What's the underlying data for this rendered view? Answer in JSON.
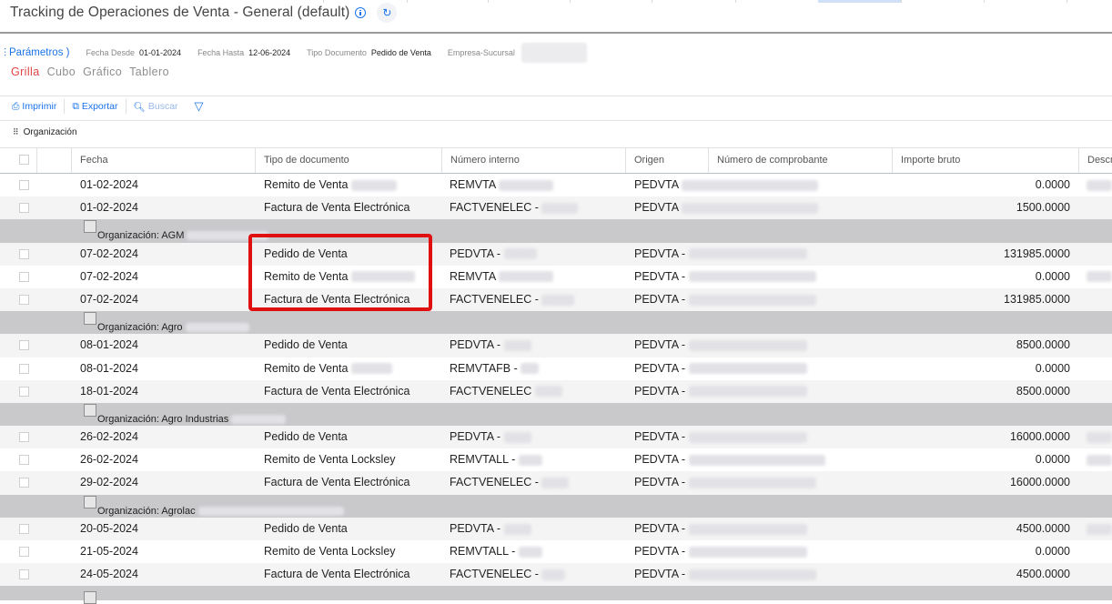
{
  "page": {
    "title": "Tracking de Operaciones de Venta - General (default)"
  },
  "params": {
    "link_label": "Parámetros )",
    "fecha_desde_label": "Fecha Desde",
    "fecha_desde_value": "01-01-2024",
    "fecha_hasta_label": "Fecha Hasta",
    "fecha_hasta_value": "12-06-2024",
    "tipo_doc_label": "Tipo Documento",
    "tipo_doc_value": "Pedido de Venta",
    "empresa_label": "Empresa-Sucursal"
  },
  "views": [
    "Grilla",
    "Cubo",
    "Gráfico",
    "Tablero"
  ],
  "toolbar": {
    "imprimir": "Imprimir",
    "exportar": "Exportar",
    "buscar": "Buscar"
  },
  "grouping_label": "Organización",
  "columns": [
    "Fecha",
    "Tipo de documento",
    "Número interno",
    "Origen",
    "Número de comprobante",
    "Importe bruto",
    "Descr"
  ],
  "rows_a": [
    {
      "fecha": "01-02-2024",
      "tipo": "Remito de Venta",
      "interno": "REMVTA",
      "origen": "PEDVTA",
      "importe": "0.0000"
    },
    {
      "fecha": "01-02-2024",
      "tipo": "Factura de Venta Electrónica",
      "interno": "FACTVENELEC -",
      "origen": "PEDVTA",
      "importe": "1500.0000"
    }
  ],
  "group_1": "Organización: AGM",
  "rows_b": [
    {
      "fecha": "07-02-2024",
      "tipo": "Pedido de Venta",
      "interno": "PEDVTA -",
      "origen": "PEDVTA -",
      "importe": "131985.0000"
    },
    {
      "fecha": "07-02-2024",
      "tipo": "Remito de Venta",
      "interno": "REMVTA",
      "origen": "PEDVTA -",
      "importe": "0.0000"
    },
    {
      "fecha": "07-02-2024",
      "tipo": "Factura de Venta Electrónica",
      "interno": "FACTVENELEC -",
      "origen": "PEDVTA -",
      "importe": "131985.0000"
    }
  ],
  "group_2": "Organización: Agro",
  "rows_c": [
    {
      "fecha": "08-01-2024",
      "tipo": "Pedido de Venta",
      "interno": "PEDVTA -",
      "origen": "PEDVTA -",
      "importe": "8500.0000"
    },
    {
      "fecha": "08-01-2024",
      "tipo": "Remito de Venta",
      "interno": "REMVTAFB -",
      "origen": "PEDVTA -",
      "importe": "0.0000"
    },
    {
      "fecha": "18-01-2024",
      "tipo": "Factura de Venta Electrónica",
      "interno": "FACTVENELEC",
      "origen": "PEDVTA -",
      "importe": "8500.0000"
    }
  ],
  "group_3": "Organización: Agro Industrias",
  "rows_d": [
    {
      "fecha": "26-02-2024",
      "tipo": "Pedido de Venta",
      "interno": "PEDVTA -",
      "origen": "PEDVTA -",
      "importe": "16000.0000"
    },
    {
      "fecha": "26-02-2024",
      "tipo": "Remito de Venta Locksley",
      "interno": "REMVTALL -",
      "origen": "PEDVTA -",
      "importe": "0.0000"
    },
    {
      "fecha": "29-02-2024",
      "tipo": "Factura de Venta Electrónica",
      "interno": "FACTVENELEC -",
      "origen": "PEDVTA -",
      "importe": "16000.0000"
    }
  ],
  "group_4": "Organización: Agrolac",
  "rows_e": [
    {
      "fecha": "20-05-2024",
      "tipo": "Pedido de Venta",
      "interno": "PEDVTA -",
      "origen": "PEDVTA -",
      "importe": "4500.0000"
    },
    {
      "fecha": "21-05-2024",
      "tipo": "Remito de Venta Locksley",
      "interno": "REMVTALL -",
      "origen": "PEDVTA -",
      "importe": "0.0000"
    },
    {
      "fecha": "24-05-2024",
      "tipo": "Factura de Venta Electrónica",
      "interno": "FACTVENELEC -",
      "origen": "PEDVTA -",
      "importe": "4500.0000"
    }
  ],
  "colors": {
    "accent": "#1a73e8",
    "active_view": "#e04444",
    "group_bg": "#c9c9cc",
    "highlight_border": "#e01010"
  }
}
